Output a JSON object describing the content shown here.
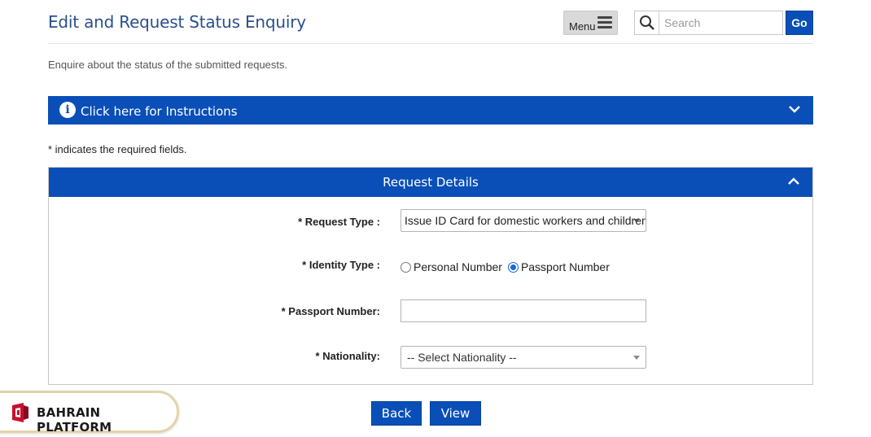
{
  "header": {
    "title": "Edit and Request Status Enquiry",
    "menu_label": "Menu",
    "search_placeholder": "Search",
    "go_label": "Go"
  },
  "subtitle": "Enquire about the status of the submitted requests.",
  "instructions": {
    "label": "Click here for Instructions"
  },
  "required_note": "* indicates the required fields.",
  "request_details": {
    "title": "Request Details",
    "request_type": {
      "label": "* Request Type :",
      "value": "Issue ID Card for domestic workers and children"
    },
    "identity_type": {
      "label": "* Identity Type :",
      "options": [
        {
          "label": "Personal Number",
          "checked": false
        },
        {
          "label": "Passport Number",
          "checked": true
        }
      ]
    },
    "passport_number": {
      "label": "* Passport Number:",
      "value": ""
    },
    "nationality": {
      "label": "* Nationality:",
      "value": "-- Select Nationality --"
    }
  },
  "actions": {
    "back_label": "Back",
    "view_label": "View"
  },
  "platform_badge": {
    "label": "BAHRAIN PLATFORM"
  },
  "colors": {
    "primary": "#0a4fb8",
    "title": "#2a4f8f",
    "radio_checked": "#1a66d6"
  }
}
